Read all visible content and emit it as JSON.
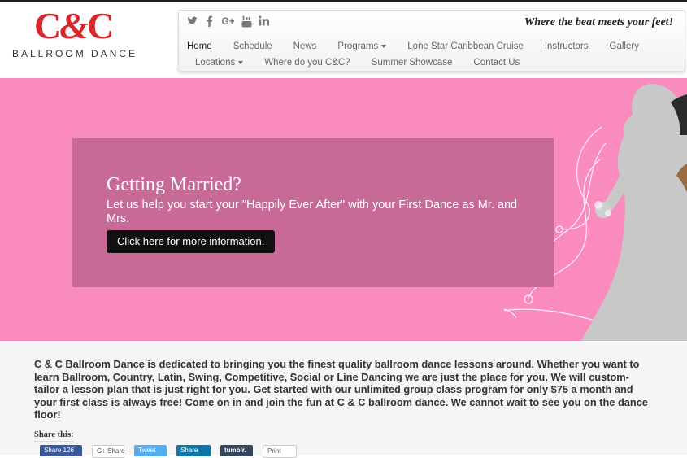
{
  "brand": {
    "logo_mark_left": "C",
    "logo_mark_amp": "&",
    "logo_mark_right": "C",
    "logo_subtitle": "BALLROOM DANCE",
    "tagline": "Where the beat meets your feet!"
  },
  "social_icons": [
    "twitter-icon",
    "facebook-icon",
    "google-plus-icon",
    "youtube-icon",
    "linkedin-icon"
  ],
  "nav": {
    "row1": [
      {
        "label": "Home",
        "active": true,
        "dropdown": false
      },
      {
        "label": "Schedule",
        "active": false,
        "dropdown": false
      },
      {
        "label": "News",
        "active": false,
        "dropdown": false
      },
      {
        "label": "Programs",
        "active": false,
        "dropdown": true
      },
      {
        "label": "Lone Star Caribbean Cruise",
        "active": false,
        "dropdown": false
      },
      {
        "label": "Instructors",
        "active": false,
        "dropdown": false
      },
      {
        "label": "Gallery",
        "active": false,
        "dropdown": false
      }
    ],
    "row2": [
      {
        "label": "Locations",
        "active": false,
        "dropdown": true
      },
      {
        "label": "Where do you C&C?",
        "active": false,
        "dropdown": false
      },
      {
        "label": "Summer Showcase",
        "active": false,
        "dropdown": false
      },
      {
        "label": "Contact Us",
        "active": false,
        "dropdown": false
      }
    ]
  },
  "hero": {
    "title": "Getting Married?",
    "text": "Let us help you start your \"Happily Ever After\" with your First Dance as Mr. and Mrs.",
    "button": "Click here for more information."
  },
  "content": {
    "intro": "C & C Ballroom Dance is dedicated to bringing you the finest quality ballroom dance lessons around. Whether you want to learn Ballroom, Country, Latin, Swing, Competitive, Social or Line Dancing we are just the place for you. We will custom-tailor a lesson plan that is just right for you. Get started with our unlimited group class program for only $75 a month and your first class is always free! Come on in and join the fun at C & C ballroom dance. We cannot wait to see you on the dance floor!",
    "share_label": "Share this:",
    "share_buttons": {
      "facebook": "Share 126",
      "google": "G+ Share",
      "twitter": "Tweet",
      "linkedin": "Share",
      "tumblr": "tumblr.",
      "print": "Print"
    }
  },
  "colors": {
    "brand_red": "#d8262b",
    "hero_pink": "#f98bbf",
    "hero_box": "#c86a97"
  }
}
